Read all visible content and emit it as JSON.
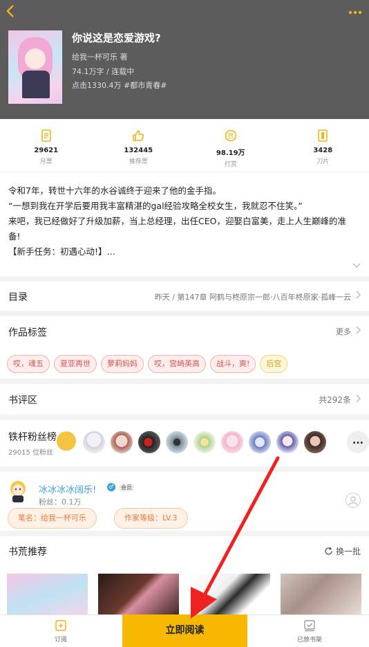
{
  "header": {
    "back_icon": "back-chevron-icon",
    "more_icon": "more-dots-icon",
    "title": "你说这是恋爱游戏?",
    "author": "给我一杯可乐 著",
    "meta": "74.1万字 / 连载中",
    "clicks": "点击1330.4万 #都市青春#"
  },
  "stats": [
    {
      "icon": "monthly-ticket-icon",
      "value": "29621",
      "label": "月票"
    },
    {
      "icon": "thumbs-up-icon",
      "value": "132445",
      "label": "推荐票"
    },
    {
      "icon": "reward-coin-icon",
      "value": "98.19万",
      "label": "打赏"
    },
    {
      "icon": "blade-icon",
      "value": "3428",
      "label": "刀片"
    }
  ],
  "synopsis": {
    "lines": [
      "令和7年，转世十六年的水谷诚终于迎来了他的金手指。",
      "“一想到我在开学后要用我丰富精湛的gal经验攻略全校女生，我就忍不住笑。”",
      "来吧，我已经做好了升级加薪，当上总经理，出任CEO，迎娶白富美，走上人生巅峰的准",
      "备!",
      "【新手任务：初遇心动!】…"
    ]
  },
  "toc": {
    "title": "目录",
    "latest": "昨天 / 第147章 阿鹤与柊原宗一郎·八百年柊原家·孤峰一云"
  },
  "tags_section": {
    "title": "作品标签",
    "more": "更多",
    "tags": [
      "哎，魂五",
      "夏亚再世",
      "萝莉妈妈",
      "哎，宫崎英高",
      "战斗，爽!",
      "后宫"
    ]
  },
  "reviews": {
    "title": "书评区",
    "count": "共292条"
  },
  "fans": {
    "title": "铁杆粉丝榜",
    "count": "29015 位粉丝",
    "more": "..."
  },
  "author_card": {
    "name": "冰冰冰冰阔乐!",
    "fans": "粉丝：0.1万",
    "vip": "会员",
    "pen_name": "笔名：给我一杯可乐",
    "level": "作家等级：LV.3"
  },
  "recommend": {
    "title": "书荒推荐",
    "refresh": "换一批"
  },
  "bottom": {
    "subscribe": "订阅",
    "read": "立即阅读",
    "shelf": "已放书架"
  },
  "colors": {
    "accent": "#f6b800",
    "header_bg": "#5c5c5c",
    "tag_red": "#d9534f",
    "arrow": "#ee2222"
  }
}
